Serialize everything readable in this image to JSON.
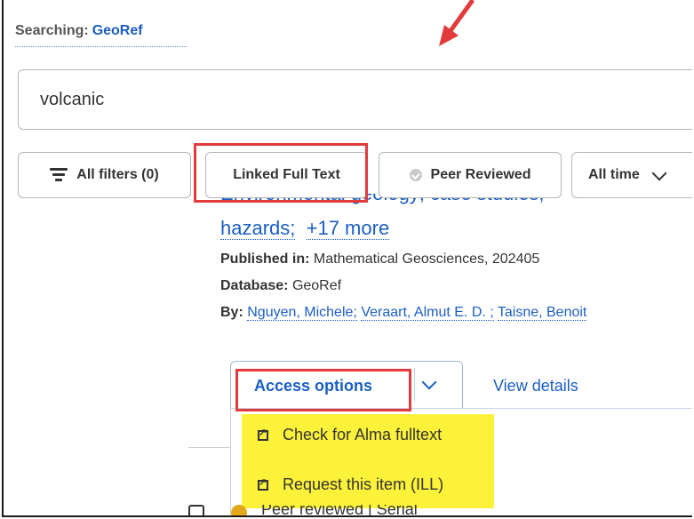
{
  "searching": {
    "label": "Searching:",
    "database": "GeoRef"
  },
  "search": {
    "value": "volcanic"
  },
  "filters": {
    "all_filters": "All filters (0)",
    "linked_full_text": "Linked Full Text",
    "peer_reviewed": "Peer Reviewed",
    "all_time": "All time"
  },
  "result": {
    "subjects_clipped": "Environmental geology;  case studies;",
    "subjects_more_1": "hazards;",
    "subjects_more_2": "+17 more",
    "published_label": "Published in:",
    "published_value": "Mathematical Geosciences, 202405",
    "database_label": "Database:",
    "database_value": "GeoRef",
    "by_label": "By:",
    "authors": [
      "Nguyen, Michele;",
      "Veraart, Almut E. D. ;",
      "Taisne, Benoit"
    ]
  },
  "access": {
    "label": "Access options",
    "view_details": "View details",
    "menu": [
      "Check for Alma fulltext",
      "Request this item (ILL)"
    ]
  },
  "next_result": {
    "badge": "Peer reviewed  |  Serial"
  },
  "colors": {
    "link": "#1b5ec2",
    "annotation": "#e23b3b",
    "highlight": "#fdf23a"
  }
}
